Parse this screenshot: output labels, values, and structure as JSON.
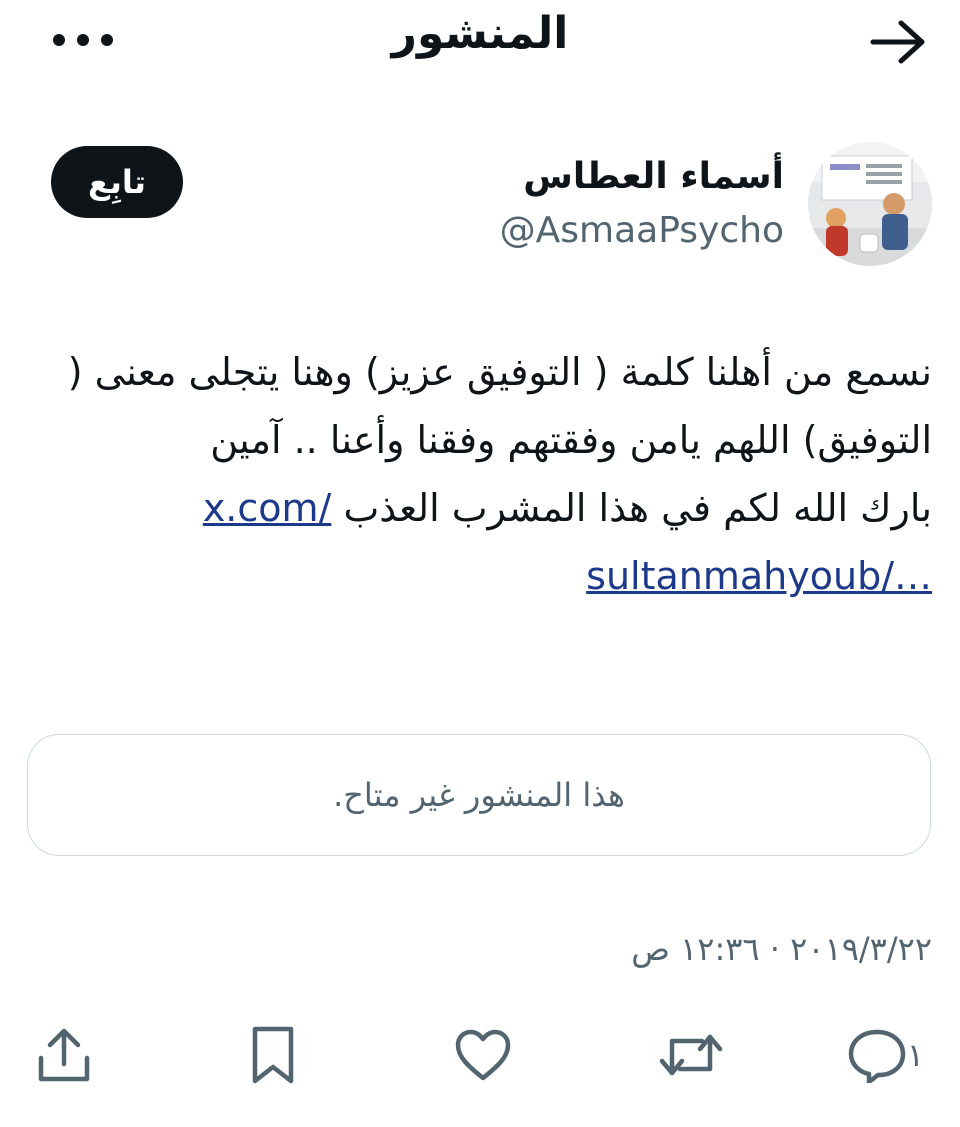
{
  "header": {
    "title": "المنشور",
    "back_icon": "arrow-back-icon",
    "more_icon": "more-icon"
  },
  "author": {
    "display_name": "أسماء العطاس",
    "handle": "@AsmaaPsycho",
    "follow_label": "تابِع",
    "avatar_icon": "avatar"
  },
  "post": {
    "line1": "نسمع من أهلنا كلمة ( التوفيق عزيز) وهنا يتجلى معنى ( التوفيق) اللهم يامن وفقتهم وفقنا وأعنا .. آمين",
    "line2": "بارك الله لكم في هذا المشرب العذب",
    "link_part1": "x.com/",
    "link_part2": "sultanmahyoub/…",
    "quote_unavailable": "هذا المنشور غير متاح.",
    "timestamp": "٢٠١٩/٣/٢٢ · ١٢:٣٦ ص"
  },
  "actions": {
    "reply_count": "١",
    "icons": [
      "reply-icon",
      "repost-icon",
      "like-icon",
      "bookmark-icon",
      "share-icon"
    ]
  },
  "colors": {
    "text": "#0f1419",
    "secondary": "#536471",
    "link": "#1d3a8a",
    "border": "#cfd9de",
    "follow_bg": "#0f1419"
  }
}
